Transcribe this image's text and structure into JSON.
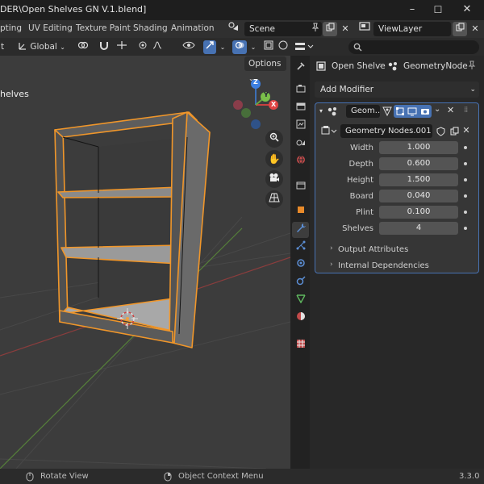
{
  "window": {
    "title": "DER\\Open Shelves GN V.1.blend]",
    "minimize": "–",
    "maximize": "☐",
    "close": "✕"
  },
  "workspaces": [
    "pting",
    "UV Editing",
    "Texture Paint",
    "Shading",
    "Animation"
  ],
  "scene": {
    "name": "Scene"
  },
  "view_layer": {
    "name": "ViewLayer"
  },
  "viewport_header": {
    "mode_cut": "t",
    "transform_orientation": "Global"
  },
  "viewport": {
    "options_label": "Options",
    "object_name_cut": "helves",
    "gizmo": {
      "z": "Z",
      "y": "Y",
      "x": "X"
    }
  },
  "properties": {
    "search_placeholder": "",
    "breadcrumb": {
      "object": "Open Shelve",
      "modifier": "GeometryNode"
    },
    "add_modifier": "Add Modifier",
    "modifier": {
      "name": "Geom...",
      "node_group": "Geometry Nodes.001",
      "params": [
        {
          "label": "Width",
          "value": "1.000"
        },
        {
          "label": "Depth",
          "value": "0.600"
        },
        {
          "label": "Height",
          "value": "1.500"
        },
        {
          "label": "Board",
          "value": "0.040"
        },
        {
          "label": "Plint",
          "value": "0.100"
        },
        {
          "label": "Shelves",
          "value": "4"
        }
      ],
      "subpanels": [
        "Output Attributes",
        "Internal Dependencies"
      ]
    }
  },
  "statusbar": {
    "rotate": "Rotate View",
    "context_menu": "Object Context Menu",
    "version": "3.3.0"
  },
  "colors": {
    "accent": "#4772b3",
    "selection": "#f0962a",
    "viewport_bg": "#3c3c3c"
  }
}
